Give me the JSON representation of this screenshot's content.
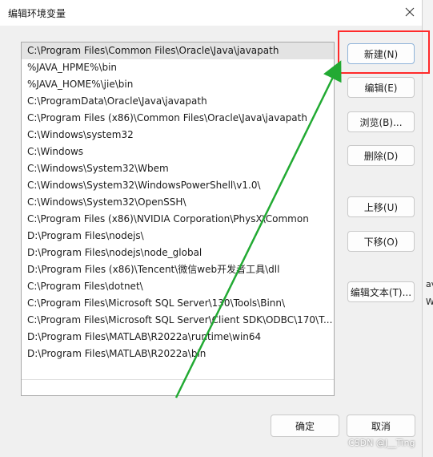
{
  "window": {
    "title": "编辑环境变量"
  },
  "path_list": [
    "C:\\Program Files\\Common Files\\Oracle\\Java\\javapath",
    "%JAVA_HPME%\\bin",
    "%JAVA_HOME%\\jie\\bin",
    "C:\\ProgramData\\Oracle\\Java\\javapath",
    "C:\\Program Files (x86)\\Common Files\\Oracle\\Java\\javapath",
    "C:\\Windows\\system32",
    "C:\\Windows",
    "C:\\Windows\\System32\\Wbem",
    "C:\\Windows\\System32\\WindowsPowerShell\\v1.0\\",
    "C:\\Windows\\System32\\OpenSSH\\",
    "C:\\Program Files (x86)\\NVIDIA Corporation\\PhysX\\Common",
    "D:\\Program Files\\nodejs\\",
    "D:\\Program Files\\nodejs\\node_global",
    "D:\\Program Files (x86)\\Tencent\\微信web开发者工具\\dll",
    "C:\\Program Files\\dotnet\\",
    "C:\\Program Files\\Microsoft SQL Server\\130\\Tools\\Binn\\",
    "C:\\Program Files\\Microsoft SQL Server\\Client SDK\\ODBC\\170\\T...",
    "D:\\Program Files\\MATLAB\\R2022a\\runtime\\win64",
    "D:\\Program Files\\MATLAB\\R2022a\\bin"
  ],
  "buttons": {
    "new": "新建(N)",
    "edit": "编辑(E)",
    "browse": "浏览(B)...",
    "delete": "删除(D)",
    "move_up": "上移(U)",
    "move_down": "下移(O)",
    "edit_text": "编辑文本(T)..."
  },
  "footer": {
    "ok": "确定",
    "cancel": "取消"
  },
  "right_fragments": [
    "av",
    "W"
  ],
  "watermark": "CSDN @J__Ting",
  "colors": {
    "highlight_box": "#ff2a2a",
    "arrow": "#22aa33"
  }
}
